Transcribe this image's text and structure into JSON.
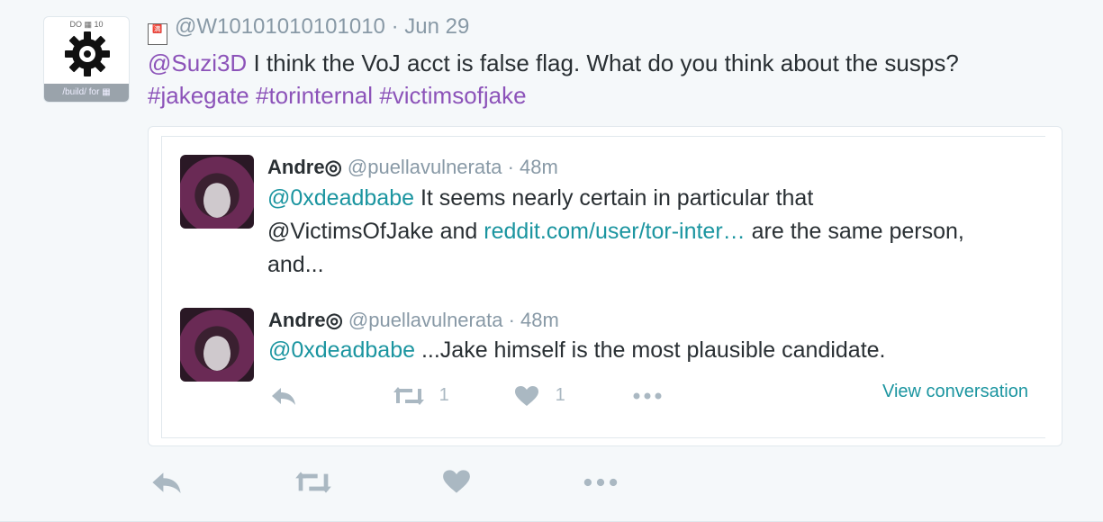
{
  "tweet": {
    "avatar": {
      "top_label": "DO ▦ 10",
      "band_label": "/build/ for ▦"
    },
    "header": {
      "emoji_label": "🈵",
      "handle": "@W10101010101010",
      "separator": "·",
      "date": "Jun 29"
    },
    "text": {
      "mention": "@Suzi3D",
      "body": " I think the VoJ acct is false flag. What do you think about the susps?",
      "hashtags": [
        "#jakegate",
        "#torinternal",
        "#victimsofjake"
      ]
    },
    "actions": {
      "reply_icon": "reply-icon",
      "retweet_icon": "retweet-icon",
      "like_icon": "heart-icon",
      "more_icon": "more-icon"
    }
  },
  "quoted": {
    "tweets": [
      {
        "name": "Andre",
        "name_badge": "◎",
        "handle": "@puellavulnerata",
        "separator": "·",
        "time": "48m",
        "mention": "@0xdeadbabe",
        "text_1": " It seems nearly certain in particular that",
        "text_2a": "@VictimsOfJake and ",
        "link": "reddit.com/user/tor-inter…",
        "text_2b": " are the same person,",
        "text_3": "and..."
      },
      {
        "name": "Andre",
        "name_badge": "◎",
        "handle": "@puellavulnerata",
        "separator": "·",
        "time": "48m",
        "mention": "@0xdeadbabe",
        "text_1": " ...Jake himself is the most plausible candidate."
      }
    ],
    "actions": {
      "retweet_count": "1",
      "like_count": "1",
      "view_conversation": "View conversation"
    }
  },
  "colors": {
    "link_purple": "#8c53b9",
    "link_teal": "#1b95a0",
    "muted": "#8899a6",
    "icon_gray": "#aab8c2"
  }
}
